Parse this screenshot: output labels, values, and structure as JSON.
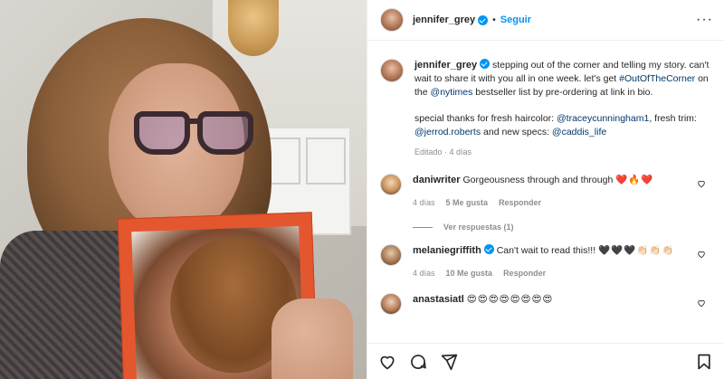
{
  "header": {
    "username": "jennifer_grey",
    "separator": "•",
    "follow_label": "Seguir",
    "more_label": "···"
  },
  "caption": {
    "username": "jennifer_grey",
    "text_1": "stepping out of the corner and telling my story. can't wait to share it with you all in one week. let's get",
    "hashtag": "#OutOfTheCorner",
    "text_2": "on the",
    "mention_nytimes": "@nytimes",
    "text_3": "bestseller list by pre-ordering at link in bio.",
    "text_4": "special thanks for fresh haircolor:",
    "mention_tracey": "@traceycunningham1",
    "text_5": ", fresh trim:",
    "mention_jerrod": "@jerrod.roberts",
    "text_6": "and new specs:",
    "mention_caddis": "@caddis_life",
    "meta": "Editado · 4 días"
  },
  "comments": [
    {
      "username": "daniwriter",
      "text": "Gorgeousness through and through",
      "emoji": "❤️🔥❤️",
      "time": "4 días",
      "likes": "5 Me gusta",
      "reply": "Responder",
      "view_replies": "Ver respuestas (1)"
    },
    {
      "username": "melaniegriffith",
      "text": "Can't wait to read this!!!",
      "emoji": "🖤🖤🖤👏🏻👏🏻👏🏻",
      "time": "4 días",
      "likes": "10 Me gusta",
      "reply": "Responder"
    },
    {
      "username": "anastasiatl",
      "emoji": "😍😍😍😍😍😍😍😍"
    }
  ],
  "colors": {
    "accent": "#0095f6",
    "link": "#00376b",
    "muted": "#8e8e8e"
  },
  "icons": [
    "heart-icon",
    "comment-icon",
    "share-icon",
    "bookmark-icon",
    "verified-icon",
    "more-options-icon"
  ]
}
